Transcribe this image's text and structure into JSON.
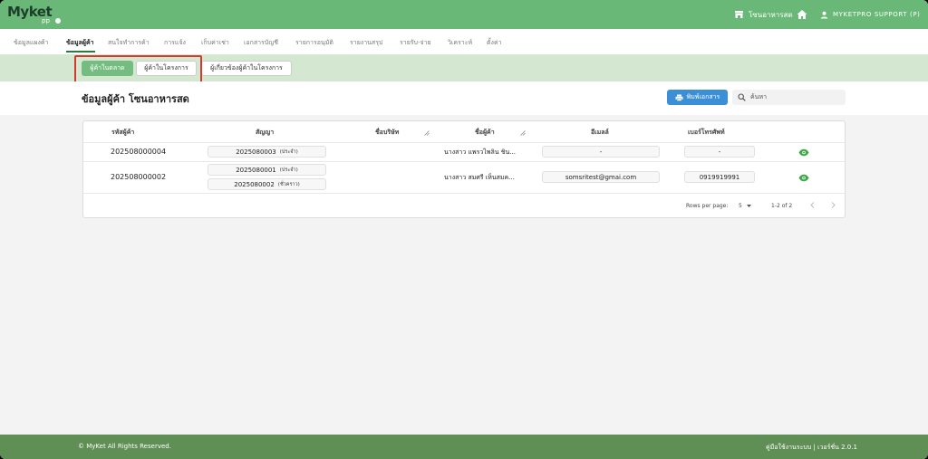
{
  "header": {
    "logo_main": "Myket",
    "logo_sub": "pp",
    "store_label": "โซนอาหารสด",
    "user_label": "MYKETPRO SUPPORT (P)"
  },
  "nav": {
    "items": [
      "ข้อมูลแผงค้า",
      "ข้อมูลผู้ค้า",
      "สนใจทำการค้า",
      "การแจ้ง",
      "เก็บค่าเช่า",
      "เอกสารบัญชี",
      "รายการอนุมัติ",
      "รายงานสรุป",
      "รายรับ-จ่าย",
      "วิเคราะห์",
      "ตั้งค่า"
    ]
  },
  "subnav": {
    "market": "ผู้ค้าในตลาด",
    "project": "ผู้ค้าในโครงการ",
    "related": "ผู้เกี่ยวข้องผู้ค้าในโครงการ"
  },
  "page": {
    "title": "ข้อมูลผู้ค้า โซนอาหารสด",
    "print_label": "พิมพ์เอกสาร",
    "search_placeholder": "ค้นหา"
  },
  "table": {
    "headers": [
      "รหัสผู้ค้า",
      "สัญญา",
      "ชื่อบริษัท",
      "ชื่อผู้ค้า",
      "อีเมลล์",
      "เบอร์โทรศัพท์"
    ],
    "rows": [
      {
        "code": "202508000004",
        "contracts": [
          {
            "number": "2025080003",
            "type": "(ประจำ)"
          }
        ],
        "company": "",
        "name": "นางสาว แพรวไพลิน ชิน...",
        "email": "-",
        "phone": "-"
      },
      {
        "code": "202508000002",
        "contracts": [
          {
            "number": "2025080001",
            "type": "(ประจำ)"
          },
          {
            "number": "2025080002",
            "type": "(ชั่วคราว)"
          }
        ],
        "company": "",
        "name": "นางสาว สมศรี เห็นสมค...",
        "email": "somsritest@gmai.com",
        "phone": "0919919991"
      }
    ],
    "rows_per_page_label": "Rows per page:",
    "rows_per_page": "5",
    "range": "1-2 of 2"
  },
  "footer": {
    "copyright": "© MyKet All Rights Reserved.",
    "manual": "คู่มือใช้งานระบบ",
    "separator": "|",
    "version": "เวอร์ชั่น 2.0.1"
  },
  "colors": {
    "brand_green": "#6ab878",
    "footer_green": "#5f8f54",
    "print_blue": "#3b8fd6",
    "highlight_red": "#d23a2e"
  }
}
